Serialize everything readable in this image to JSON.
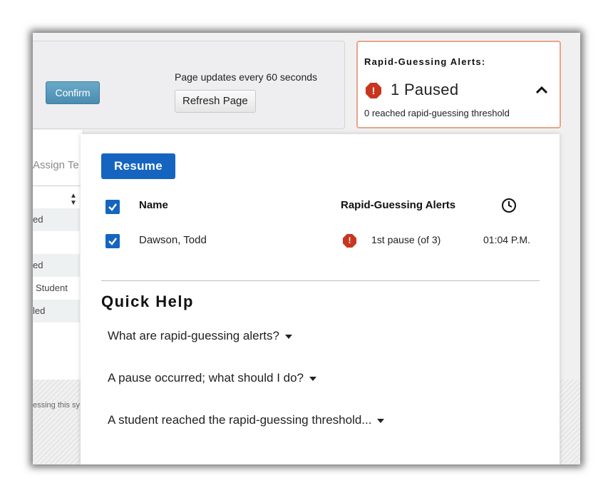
{
  "topbar": {
    "confirm_label": "Confirm",
    "updates_text": "Page updates every 60 seconds",
    "refresh_label": "Refresh Page"
  },
  "alerts": {
    "title": "Rapid-Guessing Alerts:",
    "icon": "exclamation-octagon",
    "paused_text": "1 Paused",
    "threshold_text": "0 reached rapid-guessing threshold",
    "expanded": true
  },
  "left_panel": {
    "assign_label": "Assign Te",
    "rows": [
      "ed",
      "",
      "ed",
      "Student",
      "led"
    ],
    "footer_text": "essing this sy"
  },
  "dropdown": {
    "resume_label": "Resume",
    "table": {
      "headers": {
        "name": "Name",
        "alerts": "Rapid-Guessing Alerts",
        "time_icon": "clock-icon"
      },
      "rows": [
        {
          "checked": true,
          "name": "Dawson, Todd",
          "alert": "1st pause (of 3)",
          "time": "01:04 P.M."
        }
      ]
    },
    "quick_help": {
      "title": "Quick Help",
      "items": [
        "What are rapid-guessing alerts?",
        "A pause occurred; what should I do?",
        "A student reached the rapid-guessing threshold..."
      ]
    }
  },
  "colors": {
    "primary": "#1565c0",
    "alert": "#c9361f",
    "alert_border": "#e8a58a",
    "confirm": "#4a8cb0"
  }
}
